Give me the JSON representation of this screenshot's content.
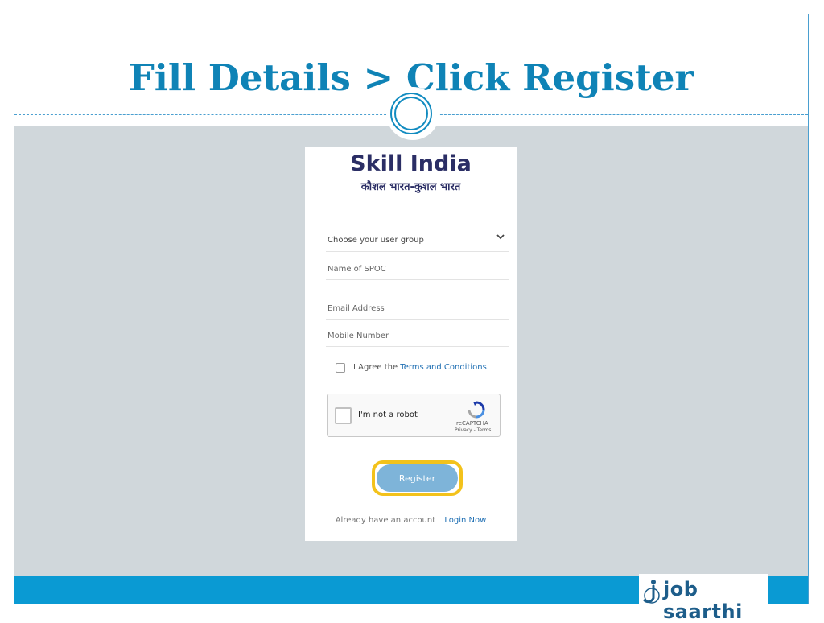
{
  "slide": {
    "title": "Fill Details > Click Register"
  },
  "brand": {
    "name": "Skill India",
    "tagline": "कौशल भारत-कुशल भारत"
  },
  "form": {
    "user_group_select": "Choose your user group",
    "spoc_name_placeholder": "Name of SPOC",
    "email_placeholder": "Email Address",
    "mobile_placeholder": "Mobile Number",
    "agree_text": "I Agree the ",
    "terms_link": "Terms and Conditions.",
    "captcha": {
      "label": "I'm not a robot",
      "brand": "reCAPTCHA",
      "links": "Privacy - Terms"
    },
    "register_label": "Register",
    "account_text": "Already have an account",
    "login_link": "Login Now"
  },
  "footer_logo": {
    "text": "job saarthi"
  },
  "colors": {
    "title": "#0f83b6",
    "bottom_bar": "#0a9ad3",
    "content_bg": "#d0d7db",
    "register_button": "#7eb4d9",
    "register_highlight": "#f3c21b",
    "brand_text": "#2b2e65"
  },
  "icons": {
    "select": "chevron-down-icon",
    "captcha": "recaptcha-logo-icon",
    "footer": "job-saarthi-logo-icon"
  }
}
